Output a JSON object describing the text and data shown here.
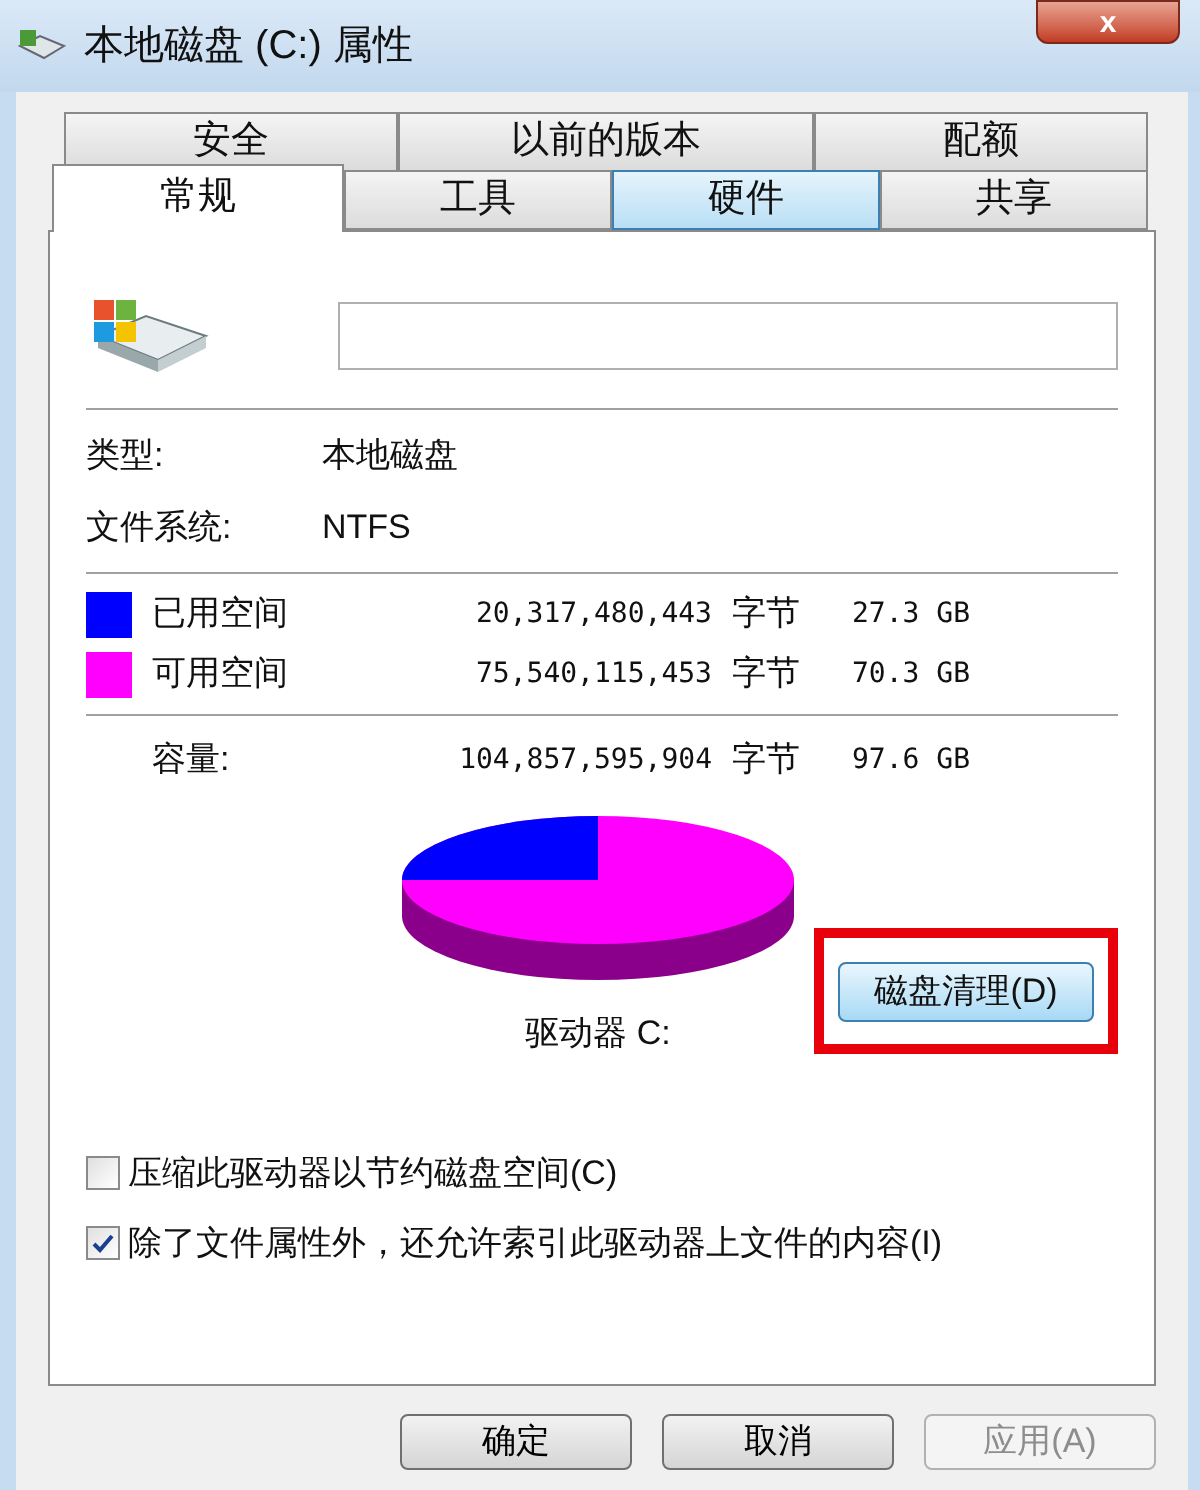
{
  "window": {
    "title": "本地磁盘 (C:) 属性",
    "close": "x"
  },
  "tabs_back": [
    {
      "label": "安全",
      "selected": false
    },
    {
      "label": "以前的版本",
      "selected": false
    },
    {
      "label": "配额",
      "selected": false
    }
  ],
  "tabs_front": [
    {
      "label": "常规",
      "selected": true,
      "hovered": false
    },
    {
      "label": "工具",
      "selected": false,
      "hovered": false
    },
    {
      "label": "硬件",
      "selected": false,
      "hovered": true
    },
    {
      "label": "共享",
      "selected": false,
      "hovered": false
    }
  ],
  "info": [
    {
      "label": "类型:",
      "value": "本地磁盘"
    },
    {
      "label": "文件系统:",
      "value": "NTFS"
    }
  ],
  "space": [
    {
      "label": "已用空间",
      "color": "#0000ff",
      "bytes": "20,317,480,443",
      "unit": "字节",
      "size": "27.3 GB"
    },
    {
      "label": "可用空间",
      "color": "#ff00ff",
      "bytes": "75,540,115,453",
      "unit": "字节",
      "size": "70.3 GB"
    }
  ],
  "capacity": {
    "label": "容量:",
    "bytes": "104,857,595,904",
    "unit": "字节",
    "size": "97.6 GB"
  },
  "drive_label": "驱动器 C:",
  "cleanup_button": "磁盘清理(D)",
  "options": [
    {
      "label": "压缩此驱动器以节约磁盘空间(C)",
      "checked": false
    },
    {
      "label": "除了文件属性外，还允许索引此驱动器上文件的内容(I)",
      "checked": true
    }
  ],
  "buttons": [
    {
      "label": "确定",
      "disabled": false
    },
    {
      "label": "取消",
      "disabled": false
    },
    {
      "label": "应用(A)",
      "disabled": true
    }
  ]
}
